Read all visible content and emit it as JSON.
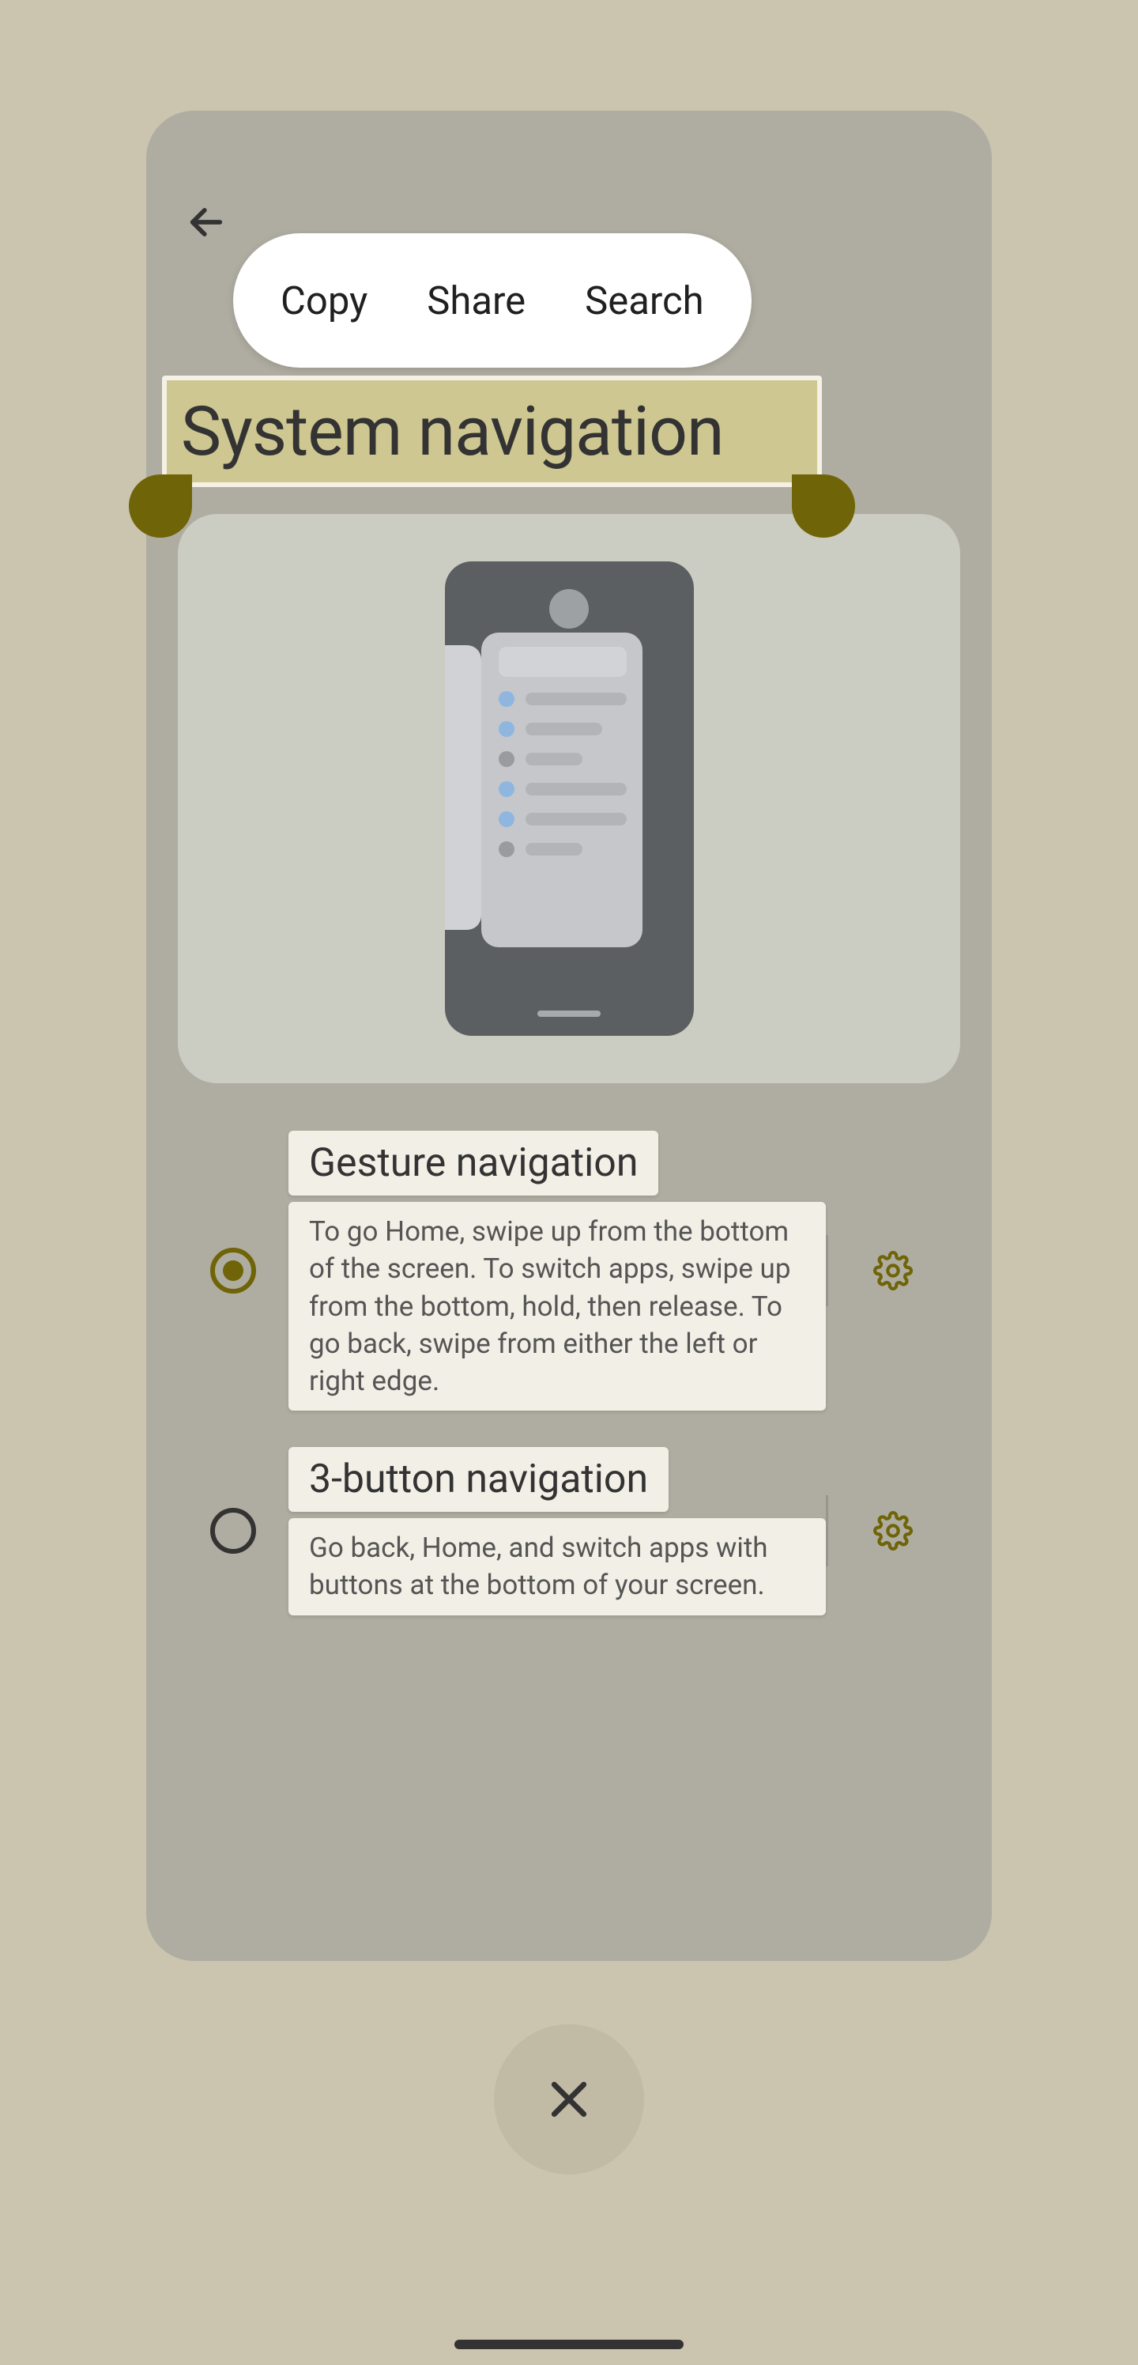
{
  "toolbar": {
    "copy_label": "Copy",
    "share_label": "Share",
    "search_label": "Search"
  },
  "page": {
    "title": "System navigation"
  },
  "options": [
    {
      "title": "Gesture navigation",
      "description": "To go Home, swipe up from the bottom of the screen. To switch apps, swipe up from the bottom, hold, then release. To go back, swipe from either the left or right edge.",
      "selected": true
    },
    {
      "title": "3-button navigation",
      "description": "Go back, Home, and switch apps with buttons at the bottom of your screen.",
      "selected": false
    }
  ],
  "colors": {
    "background": "#cbc5b0",
    "card": "#afada1",
    "accent": "#6f6407",
    "highlight": "#cec791",
    "chip": "#f2efe6"
  }
}
